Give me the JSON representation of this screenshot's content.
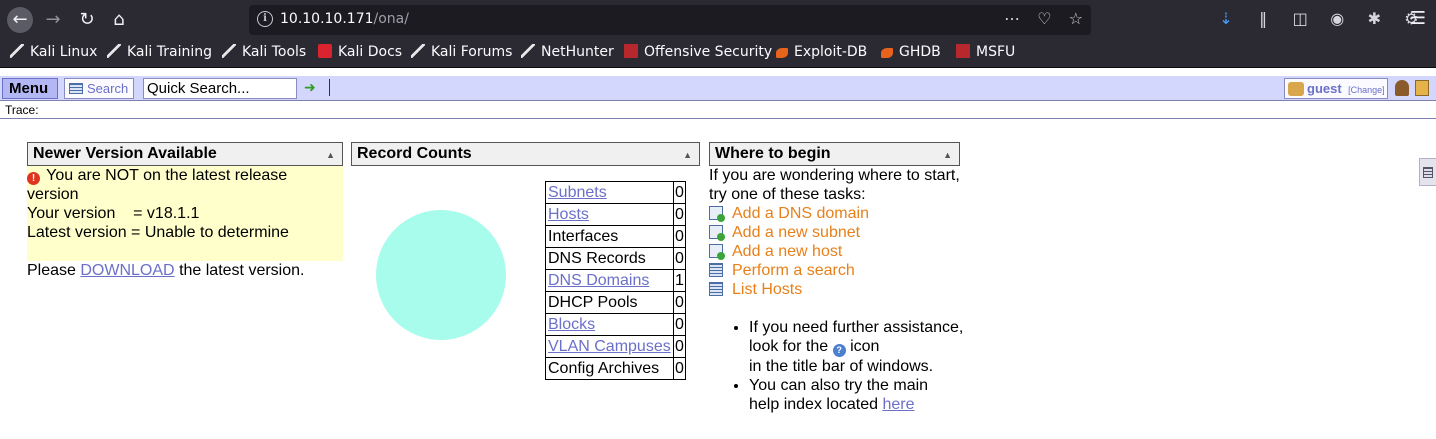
{
  "browser": {
    "url_host": "10.10.10.171",
    "url_path": "/ona/",
    "bookmarks": [
      {
        "label": "Kali Linux",
        "icon": "kali-dragon-icon"
      },
      {
        "label": "Kali Training",
        "icon": "kali-dragon-icon"
      },
      {
        "label": "Kali Tools",
        "icon": "kali-dragon-icon"
      },
      {
        "label": "Kali Docs",
        "icon": "kali-docs-icon"
      },
      {
        "label": "Kali Forums",
        "icon": "kali-dragon-icon"
      },
      {
        "label": "NetHunter",
        "icon": "kali-dragon-icon"
      },
      {
        "label": "Offensive Security",
        "icon": "offsec-icon"
      },
      {
        "label": "Exploit-DB",
        "icon": "exploit-db-icon"
      },
      {
        "label": "GHDB",
        "icon": "exploit-db-icon"
      },
      {
        "label": "MSFU",
        "icon": "offsec-icon"
      }
    ]
  },
  "app": {
    "menu_label": "Menu",
    "search_label": "Search",
    "quick_search_value": "Quick Search...",
    "user_name": "guest",
    "change_label": "[Change]",
    "trace_label": "Trace:"
  },
  "newer_version": {
    "title": "Newer Version Available",
    "warning": "You are NOT on the latest release version",
    "your_version": "Your version    = v18.1.1",
    "latest_version": "Latest version = Unable to determine",
    "please": "Please",
    "download": "DOWNLOAD",
    "tail": "the latest version."
  },
  "record_counts": {
    "title": "Record Counts",
    "pie_color": "#a8fcec",
    "rows": [
      {
        "label": "Subnets",
        "count": "0",
        "link": true
      },
      {
        "label": "Hosts",
        "count": "0",
        "link": true
      },
      {
        "label": "Interfaces",
        "count": "0",
        "link": false
      },
      {
        "label": "DNS Records",
        "count": "0",
        "link": false
      },
      {
        "label": "DNS Domains",
        "count": "1",
        "link": true
      },
      {
        "label": "DHCP Pools",
        "count": "0",
        "link": false
      },
      {
        "label": "Blocks",
        "count": "0",
        "link": true
      },
      {
        "label": "VLAN Campuses",
        "count": "0",
        "link": true
      },
      {
        "label": "Config Archives",
        "count": "0",
        "link": false
      }
    ]
  },
  "where_to_begin": {
    "title": "Where to begin",
    "intro_line1": "If you are wondering where to start,",
    "intro_line2": "try one of these tasks:",
    "tasks": [
      {
        "label": "Add a DNS domain"
      },
      {
        "label": "Add a new subnet"
      },
      {
        "label": "Add a new host"
      },
      {
        "label": "Perform a search"
      },
      {
        "label": "List Hosts"
      }
    ],
    "tip1_line1": "If you need further assistance,",
    "tip1_line2a": "look for the",
    "tip1_line2b": "icon",
    "tip1_line3": "in the title bar of windows.",
    "tip2_line1": "You can also try the main",
    "tip2_line2": "help index located",
    "tip2_link": "here"
  }
}
